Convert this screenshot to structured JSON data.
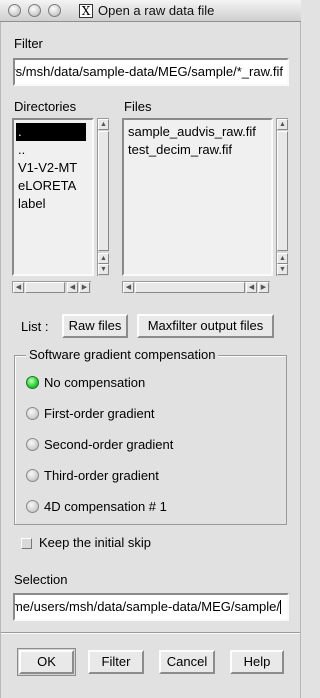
{
  "window": {
    "title": "Open a raw data file"
  },
  "filter": {
    "label": "Filter",
    "value": "/home/users/msh/data/sample-data/MEG/sample/*_raw.fif"
  },
  "directories": {
    "label": "Directories",
    "items": [
      ".",
      "..",
      "V1-V2-MT",
      "eLORETA",
      "label"
    ],
    "selected_index": 0
  },
  "files": {
    "label": "Files",
    "items": [
      "sample_audvis_raw.fif",
      "test_decim_raw.fif"
    ]
  },
  "list_buttons": {
    "label": "List :",
    "raw_files": "Raw files",
    "maxfilter": "Maxfilter output files"
  },
  "gradient": {
    "title": "Software gradient compensation",
    "options": [
      "No compensation",
      "First-order gradient",
      "Second-order gradient",
      "Third-order gradient",
      "4D compensation # 1"
    ],
    "selected_index": 0,
    "selected_color": "#2fd23a"
  },
  "keep_skip": {
    "label": "Keep the initial skip",
    "checked": false
  },
  "selection": {
    "label": "Selection",
    "value": "/home/users/msh/data/sample-data/MEG/sample/"
  },
  "actions": {
    "ok": "OK",
    "filter": "Filter",
    "cancel": "Cancel",
    "help": "Help"
  }
}
